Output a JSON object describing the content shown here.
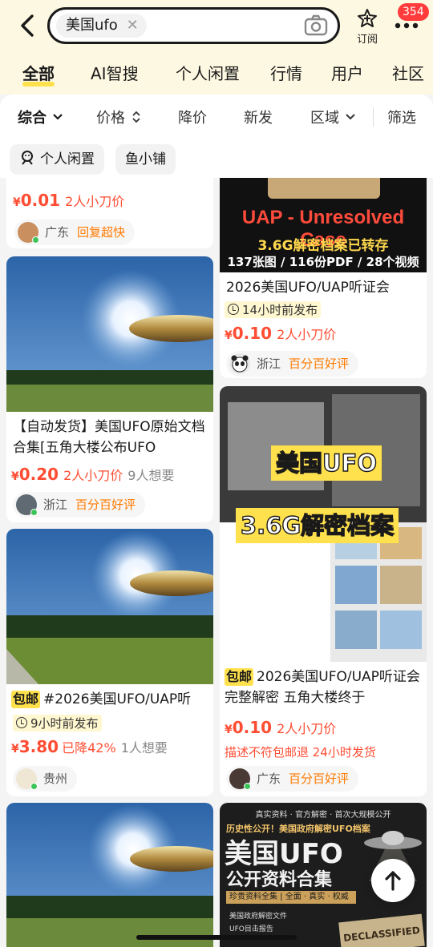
{
  "search": {
    "query": "美国ufo",
    "subscribe_label": "订阅",
    "badge_count": "354"
  },
  "categories": [
    "全部",
    "AI智搜",
    "个人闲置",
    "行情",
    "用户",
    "社区"
  ],
  "filters": [
    "综合",
    "价格",
    "降价",
    "新发",
    "区域",
    "筛选"
  ],
  "quick_filters": [
    "个人闲置",
    "鱼小铺"
  ],
  "cards": [
    {
      "id": "c1",
      "price": "0.01",
      "want": "2人小刀价",
      "region": "广东",
      "seller_badge": "回复超快"
    },
    {
      "id": "c2",
      "cover_lines": [
        "UAP - Unresolved Case",
        "3.6G解密档案已转存",
        "137张图 / 116份PDF / 28个视频"
      ],
      "title": "2026美国UFO/UAP听证会",
      "time": "14小时前发布",
      "price": "0.10",
      "want": "2人小刀价",
      "region": "浙江",
      "seller_badge": "百分百好评"
    },
    {
      "id": "c3",
      "title": "【自动发货】美国UFO原始文档合集[五角大楼公布UFO",
      "price": "0.20",
      "want": "2人小刀价",
      "meta": "9人想要",
      "region": "浙江",
      "seller_badge": "百分百好评"
    },
    {
      "id": "c4",
      "cover_lines": [
        "美国UFO",
        "3.6G解密档案"
      ],
      "tag": "包邮",
      "title": "2026美国UFO/UAP听证会完整解密 五角大楼终于",
      "price": "0.10",
      "want": "2人小刀价",
      "promise": "描述不符包邮退   24小时发货",
      "region": "广东",
      "seller_badge": "百分百好评"
    },
    {
      "id": "c5",
      "tag": "包邮",
      "title": "#2026美国UFO/UAP听",
      "time": "9小时前发布",
      "price": "3.80",
      "drop": "已降42%",
      "meta": "1人想要",
      "region": "贵州"
    },
    {
      "id": "c6"
    },
    {
      "id": "c7",
      "cover_lines": [
        "真实资料 · 官方解密 · 首次大规模公开",
        "历史性公开！美国政府解密UFO档案",
        "美国UFO",
        "公开资料合集",
        "珍贵资料全集 | 全面 · 真实 · 权威",
        "美国政府解密文件",
        "UFO目击报告",
        "DECLASSIFIED"
      ]
    }
  ],
  "colors": {
    "accent_yellow": "#ffe14d",
    "price_red": "#ff4d33",
    "badge_orange": "#ff7a00",
    "header_bg": "#fdf8e1"
  },
  "icons": [
    "back-arrow-icon",
    "camera-icon",
    "subscribe-icon",
    "more-icon",
    "chevron-down-icon",
    "sort-icon",
    "clock-icon",
    "arrow-up-icon"
  ]
}
